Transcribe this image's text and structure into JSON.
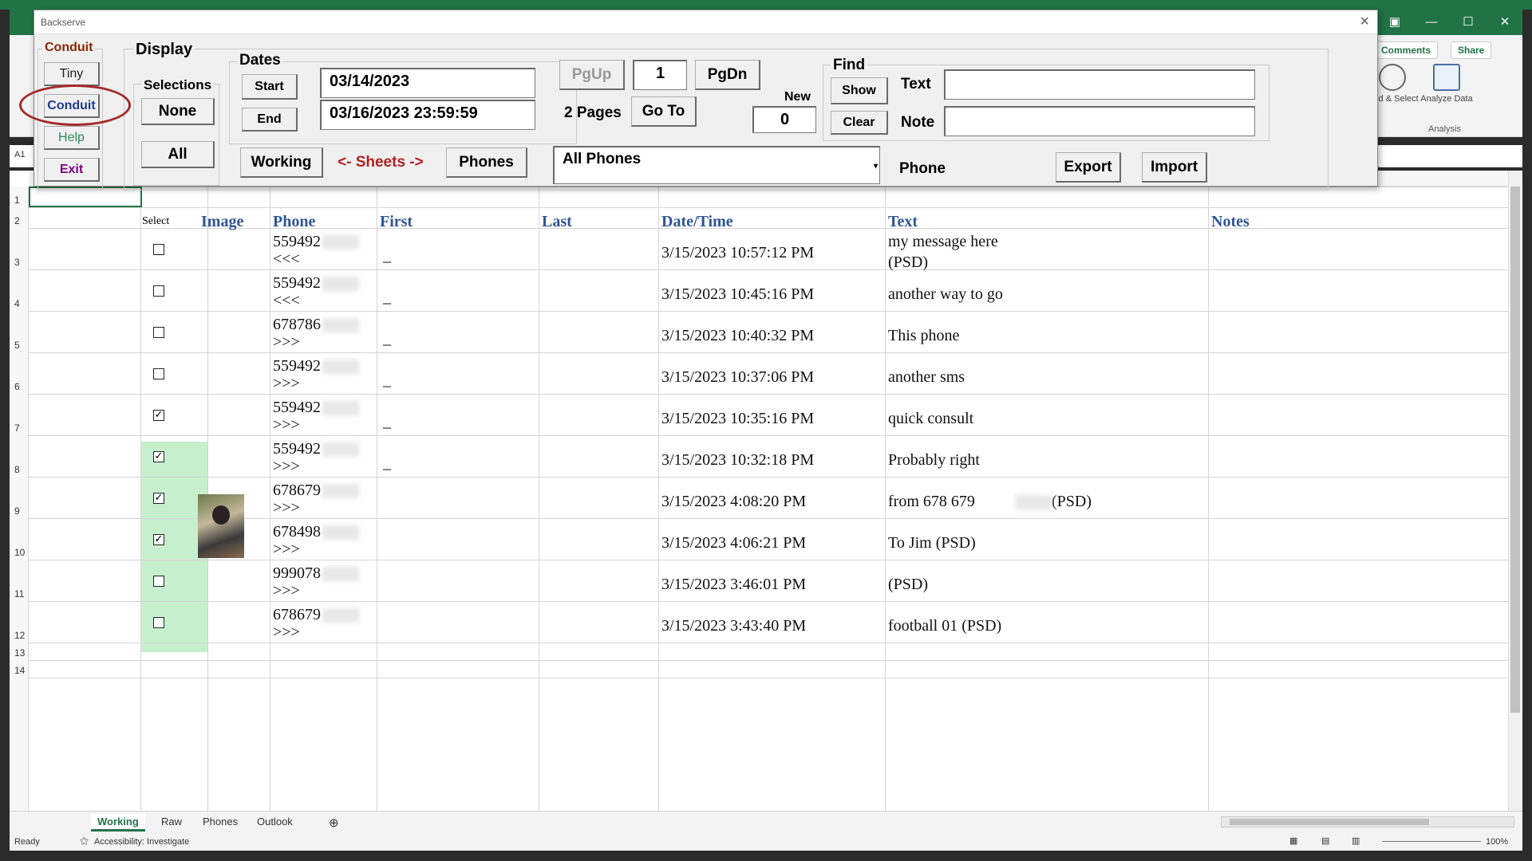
{
  "excel": {
    "name_box": "A1",
    "comments_label": "Comments",
    "share_label": "Share",
    "find_select_label": "Find & Select",
    "analyze_label": "Analyze Data",
    "analysis_group": "Analysis"
  },
  "dialog": {
    "title": "Backserve",
    "conduit_group": {
      "label": "Conduit",
      "tiny": "Tiny",
      "conduit": "Conduit",
      "help": "Help",
      "exit": "Exit"
    },
    "display_label": "Display",
    "selections": {
      "label": "Selections",
      "none": "None",
      "all": "All"
    },
    "dates": {
      "label": "Dates",
      "start_btn": "Start",
      "end_btn": "End",
      "start_value": "03/14/2023",
      "end_value": "03/16/2023 23:59:59"
    },
    "paging": {
      "pgup": "PgUp",
      "page": "1",
      "pgdn": "PgDn",
      "pages_text": "2 Pages",
      "goto": "Go To",
      "new_label": "New",
      "new_value": "0"
    },
    "sheets": {
      "working": "Working",
      "arrow_text": "<- Sheets ->",
      "phones": "Phones"
    },
    "phone_select": "All Phones",
    "phone_label": "Phone",
    "export": "Export",
    "import": "Import",
    "find": {
      "label": "Find",
      "show": "Show",
      "clear": "Clear",
      "text_label": "Text",
      "note_label": "Note",
      "text_value": "",
      "note_value": ""
    }
  },
  "sheet": {
    "row_numbers": [
      "1",
      "2",
      "3",
      "4",
      "5",
      "6",
      "7",
      "8",
      "9",
      "10",
      "11",
      "12",
      "13",
      "14"
    ],
    "headers": {
      "select": "Select",
      "image": "Image",
      "phone": "Phone",
      "first": "First",
      "last": "Last",
      "datetime": "Date/Time",
      "text": "Text",
      "notes": "Notes"
    },
    "rows": [
      {
        "phone": "559492",
        "dir": "<<<",
        "first": "_",
        "datetime": "3/15/2023 10:57:12 PM",
        "text": "my message here",
        "text2": "(PSD)",
        "checked": false
      },
      {
        "phone": "559492",
        "dir": "<<<",
        "first": "_",
        "datetime": "3/15/2023 10:45:16 PM",
        "text": "another way to go",
        "text2": "",
        "checked": false
      },
      {
        "phone": "678786",
        "dir": ">>>",
        "first": "_",
        "datetime": "3/15/2023 10:40:32 PM",
        "text": "This phone",
        "text2": "",
        "checked": false
      },
      {
        "phone": "559492",
        "dir": ">>>",
        "first": "_",
        "datetime": "3/15/2023 10:37:06 PM",
        "text": "another sms",
        "text2": "",
        "checked": false
      },
      {
        "phone": "559492",
        "dir": ">>>",
        "first": "_",
        "datetime": "3/15/2023 10:35:16 PM",
        "text": "quick consult",
        "text2": "",
        "checked": true
      },
      {
        "phone": "559492",
        "dir": ">>>",
        "first": "_",
        "datetime": "3/15/2023 10:32:18 PM",
        "text": "Probably right",
        "text2": "",
        "checked": true
      },
      {
        "phone": "678679",
        "dir": ">>>",
        "first": "",
        "datetime": "3/15/2023 4:08:20 PM",
        "text": "from 678 679",
        "text2": "(PSD)",
        "checked": true
      },
      {
        "phone": "678498",
        "dir": ">>>",
        "first": "",
        "datetime": "3/15/2023 4:06:21 PM",
        "text": "To Jim (PSD)",
        "text2": "",
        "checked": true
      },
      {
        "phone": "999078",
        "dir": ">>>",
        "first": "",
        "datetime": "3/15/2023 3:46:01 PM",
        "text": " (PSD)",
        "text2": "",
        "checked": false
      },
      {
        "phone": "678679",
        "dir": ">>>",
        "first": "",
        "datetime": "3/15/2023 3:43:40 PM",
        "text": "football 01 (PSD)",
        "text2": "",
        "checked": false
      }
    ]
  },
  "tabs": [
    "Working",
    "Raw",
    "Phones",
    "Outlook"
  ],
  "status": {
    "ready": "Ready",
    "accessibility": "Accessibility: Investigate",
    "zoom": "100%"
  },
  "colors": {
    "excel_green": "#217346",
    "header_blue": "#2f5597",
    "selected_green": "#c6efce",
    "circle_red": "#a52a2a"
  }
}
